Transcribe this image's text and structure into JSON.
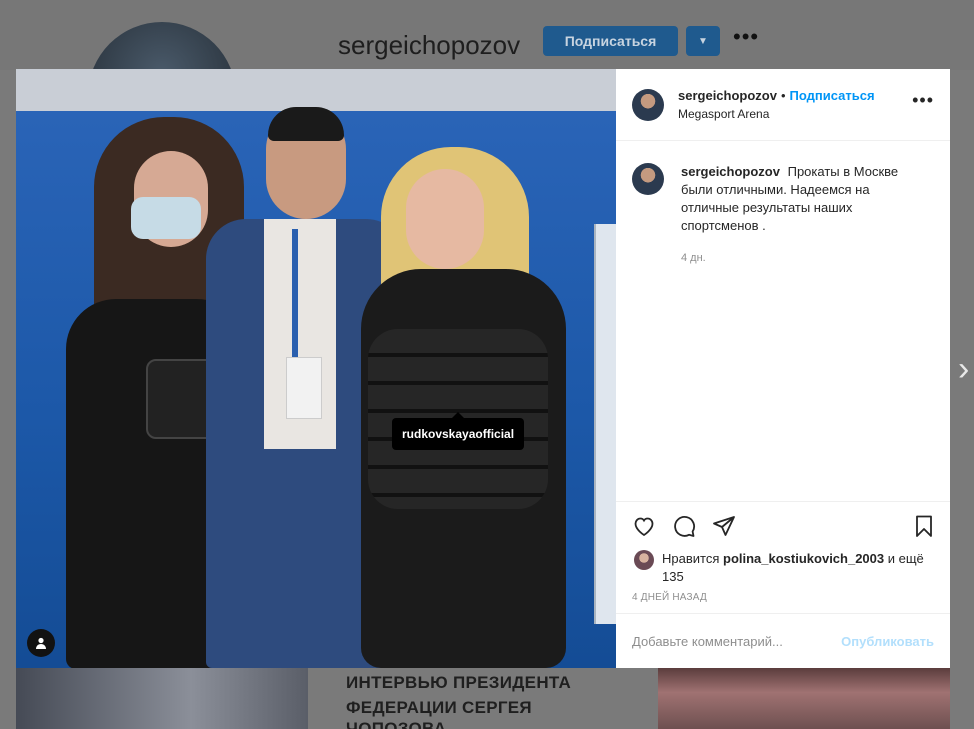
{
  "profile": {
    "username": "sergeichopozov",
    "follow_label": "Подписаться",
    "dropdown_glyph": "▼",
    "more_glyph": "•••"
  },
  "thumbnails": {
    "middle_text_line1": "ИНТЕРВЬЮ ПРЕЗИДЕНТА",
    "middle_text_line2": "ФЕДЕРАЦИИ СЕРГЕЯ ЧОПОЗОВА"
  },
  "navigation": {
    "next_glyph": "›"
  },
  "post": {
    "photo_tag": "rudkovskayaofficial",
    "header": {
      "username": "sergeichopozov",
      "separator": "•",
      "follow_label": "Подписаться",
      "location": "Megasport Arena",
      "more_glyph": "•••"
    },
    "caption": {
      "username": "sergeichopozov",
      "text": "Прокаты в Москве были отличными. Надеемся на отличные результаты наших спортсменов .",
      "time": "4 дн."
    },
    "likes": {
      "prefix": "Нравится",
      "user": "polina_kostiukovich_2003",
      "suffix": "и ещё 135"
    },
    "date": "4 ДНЕЙ НАЗАД",
    "comment_placeholder": "Добавьте комментарий...",
    "publish_label": "Опубликовать"
  },
  "colors": {
    "accent": "#0095f6",
    "publish_disabled": "#b2dffc",
    "overlay": "#7a7a7a"
  }
}
